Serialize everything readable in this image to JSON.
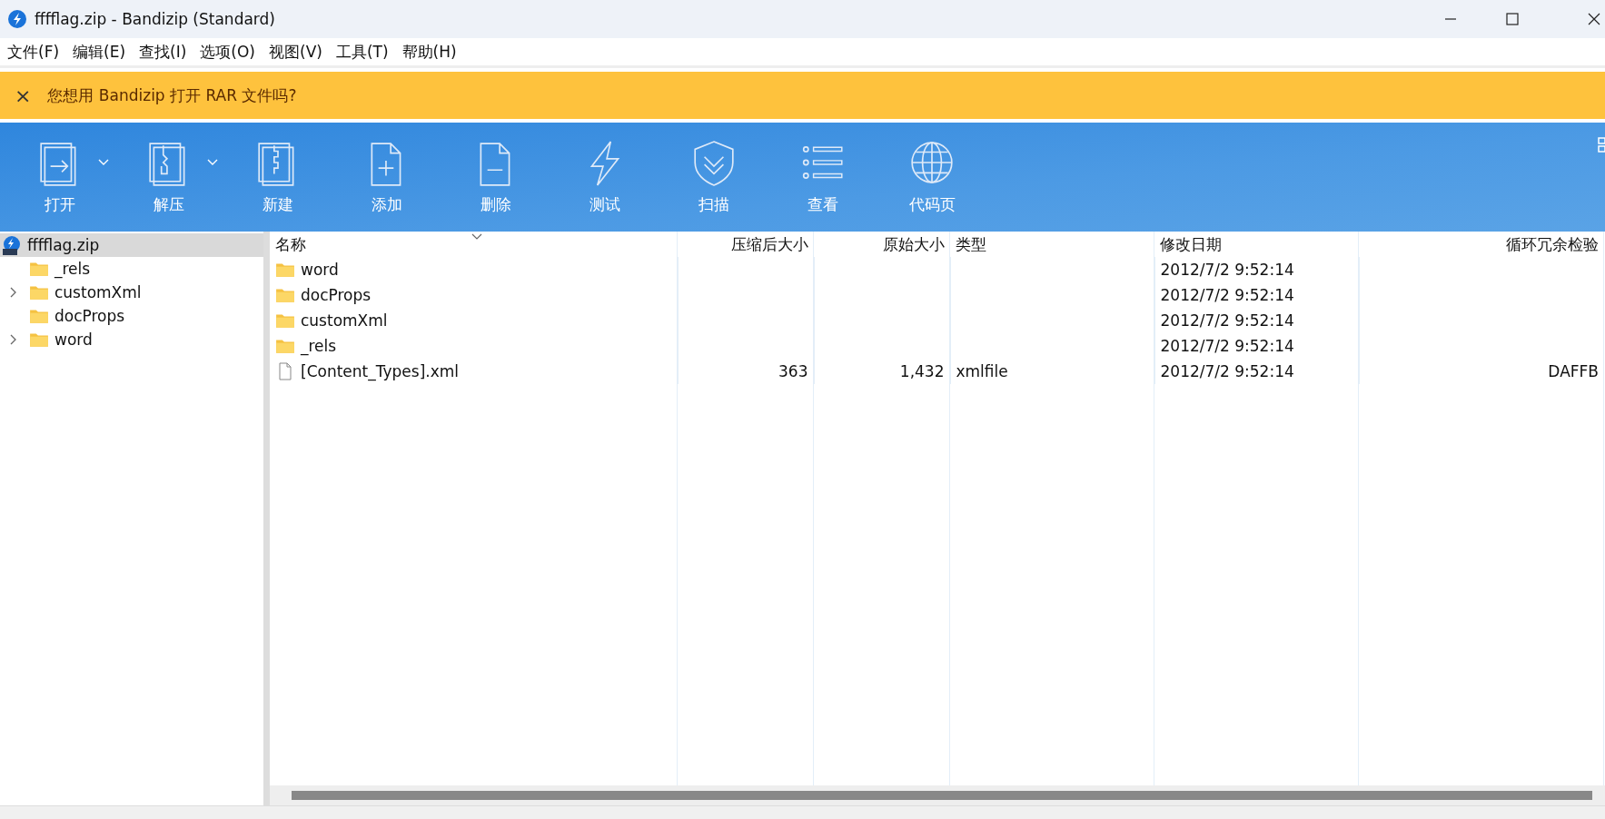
{
  "window": {
    "title": "fffflag.zip - Bandizip (Standard)"
  },
  "menu": [
    "文件(F)",
    "编辑(E)",
    "查找(I)",
    "选项(O)",
    "视图(V)",
    "工具(T)",
    "帮助(H)"
  ],
  "notice": {
    "close": "×",
    "text": "您想用 Bandizip 打开 RAR 文件吗?"
  },
  "toolbar": [
    {
      "label": "打开",
      "kind": "open",
      "dropdown": true
    },
    {
      "label": "解压",
      "kind": "extract",
      "dropdown": true
    },
    {
      "label": "新建",
      "kind": "new",
      "dropdown": false
    },
    {
      "label": "添加",
      "kind": "add",
      "dropdown": false
    },
    {
      "label": "删除",
      "kind": "delete",
      "dropdown": false
    },
    {
      "label": "测试",
      "kind": "test",
      "dropdown": false
    },
    {
      "label": "扫描",
      "kind": "scan",
      "dropdown": false
    },
    {
      "label": "查看",
      "kind": "view",
      "dropdown": false
    },
    {
      "label": "代码页",
      "kind": "codepage",
      "dropdown": false
    }
  ],
  "tree": {
    "root": {
      "label": "fffflag.zip",
      "selected": true
    },
    "items": [
      {
        "label": "_rels",
        "expandable": false,
        "selected": false
      },
      {
        "label": "customXml",
        "expandable": true,
        "selected": false
      },
      {
        "label": "docProps",
        "expandable": false,
        "selected": false
      },
      {
        "label": "word",
        "expandable": true,
        "selected": false
      }
    ]
  },
  "table": {
    "columns": [
      "名称",
      "压缩后大小",
      "原始大小",
      "类型",
      "修改日期",
      "循环冗余检验"
    ],
    "rows": [
      {
        "kind": "folder",
        "cells": [
          "word",
          "",
          "",
          "",
          "2012/7/2 9:52:14",
          ""
        ]
      },
      {
        "kind": "folder",
        "cells": [
          "docProps",
          "",
          "",
          "",
          "2012/7/2 9:52:14",
          ""
        ]
      },
      {
        "kind": "folder",
        "cells": [
          "customXml",
          "",
          "",
          "",
          "2012/7/2 9:52:14",
          ""
        ]
      },
      {
        "kind": "folder",
        "cells": [
          "_rels",
          "",
          "",
          "",
          "2012/7/2 9:52:14",
          ""
        ]
      },
      {
        "kind": "file",
        "cells": [
          "[Content_Types].xml",
          "363",
          "1,432",
          "xmlfile",
          "2012/7/2 9:52:14",
          "DAFFB"
        ]
      }
    ]
  }
}
